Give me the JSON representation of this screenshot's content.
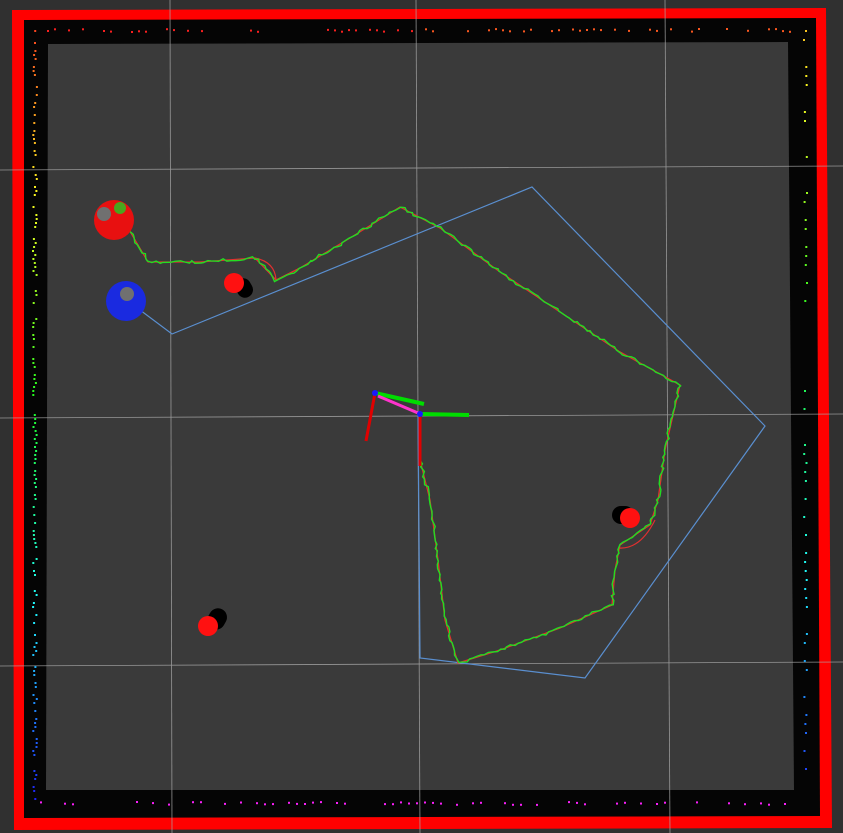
{
  "app": {
    "type": "robot-visualization-3d-view"
  },
  "colors": {
    "background": "#303030",
    "floor": "#3a3a3a",
    "grid": "#a0a0a0",
    "wall": "#ff0000",
    "wall_shadow": "#000000",
    "planned_path": "#e03030",
    "odometry_path": "#22dd22",
    "polygon": "#5a8fd0",
    "obstacle": "#ff1111",
    "robot_red": "#e81010",
    "robot_blue": "#1a2ae0",
    "axis_x": "#e00000",
    "axis_y": "#00dd00",
    "axis_z": "#1a1aff",
    "arrow": "#ff33cc"
  },
  "scene": {
    "grid": "visible",
    "robots": [
      {
        "name": "robot-red",
        "color": "red"
      },
      {
        "name": "robot-blue",
        "color": "blue"
      }
    ],
    "obstacles": [
      {
        "name": "obstacle-upper-left"
      },
      {
        "name": "obstacle-right"
      },
      {
        "name": "obstacle-lower-left"
      }
    ],
    "frames": [
      {
        "name": "frame-a"
      },
      {
        "name": "frame-b"
      }
    ]
  }
}
